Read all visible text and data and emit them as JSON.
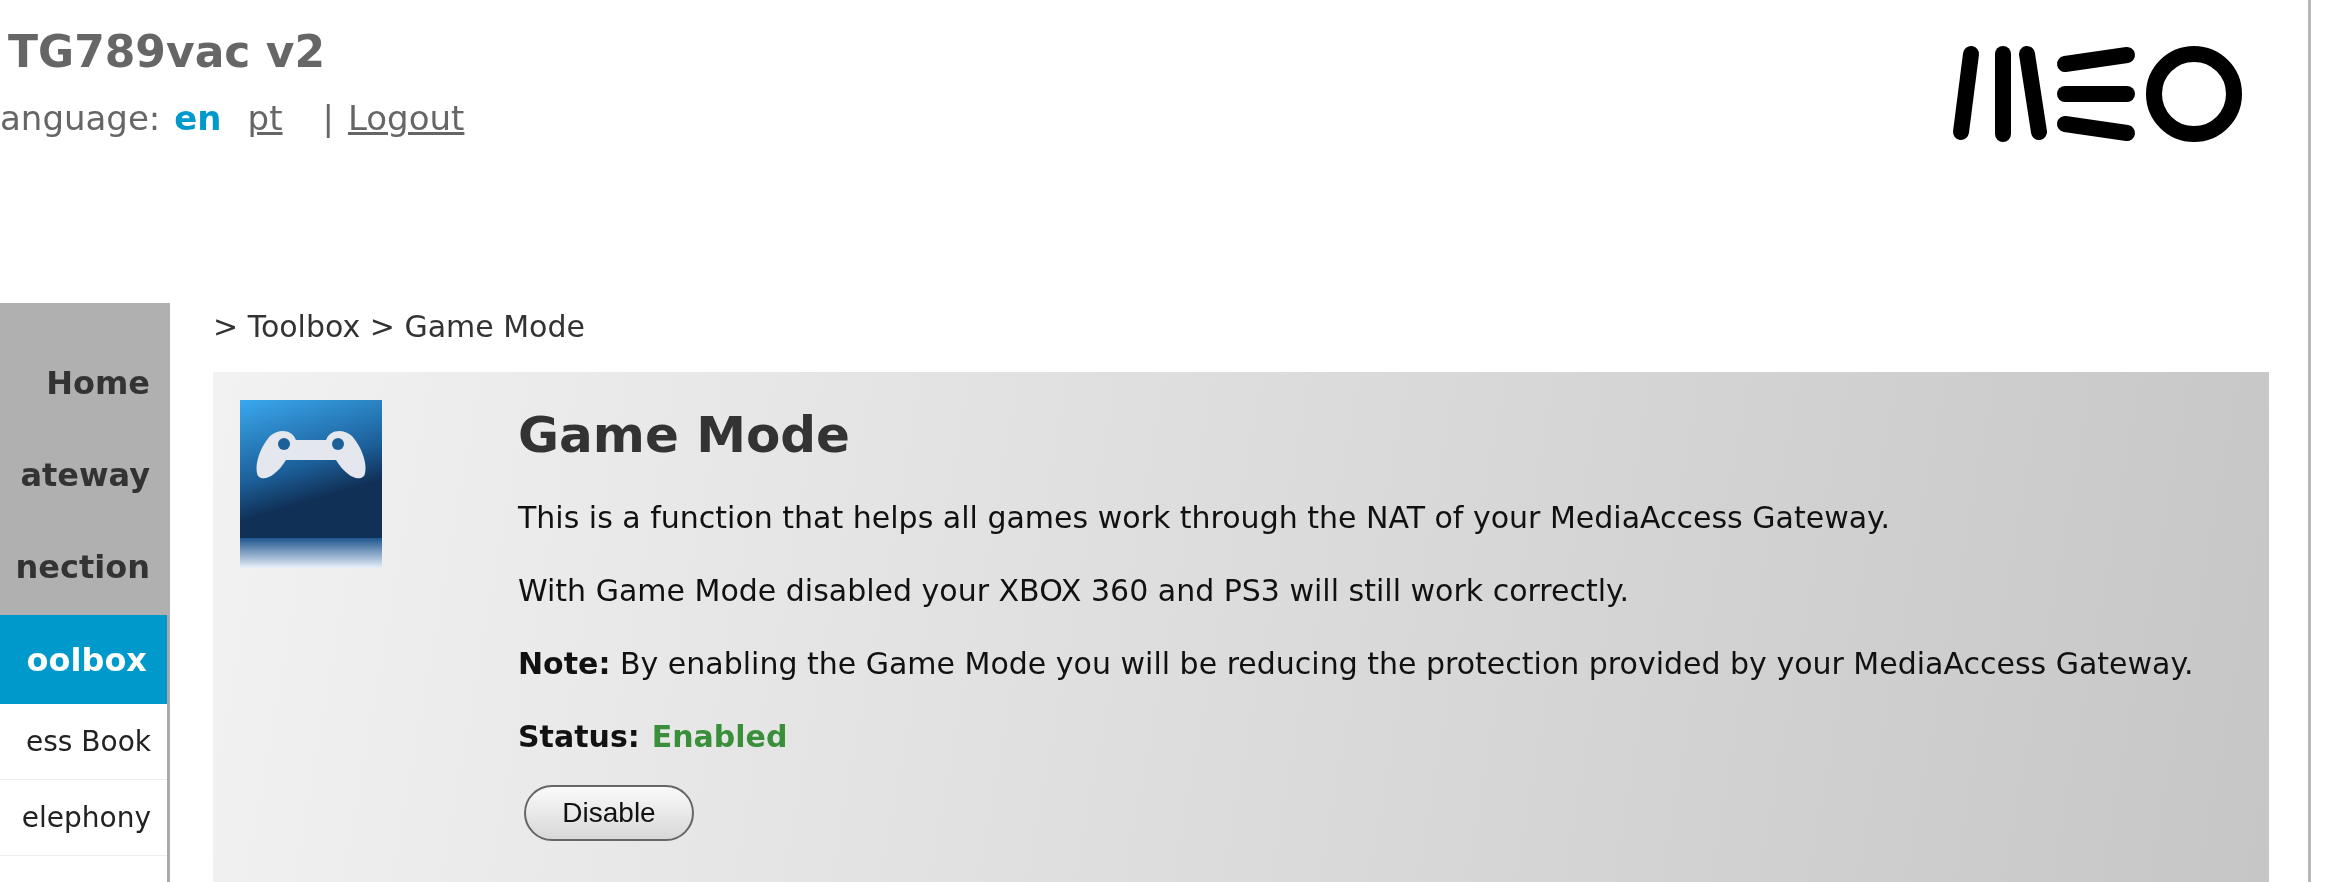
{
  "header": {
    "title": "TG789vac v2",
    "language_label": "anguage:",
    "languages": [
      {
        "label": "en",
        "selected": true
      },
      {
        "label": "pt",
        "selected": false
      }
    ],
    "separator": "|",
    "logout": "Logout"
  },
  "sidebar": {
    "items": [
      {
        "label": "Home",
        "kind": "main",
        "selected": false
      },
      {
        "label": "ateway",
        "kind": "main",
        "selected": false
      },
      {
        "label": "nection",
        "kind": "main",
        "selected": false
      },
      {
        "label": "oolbox",
        "kind": "main",
        "selected": true
      },
      {
        "label": "ess Book",
        "kind": "sub",
        "selected": false
      },
      {
        "label": "elephony",
        "kind": "sub",
        "selected": false
      }
    ]
  },
  "breadcrumb": "> Toolbox > Game Mode",
  "panel": {
    "title": "Game Mode",
    "paragraphs": [
      "This is a function that helps all games work through the NAT of your MediaAccess Gateway.",
      "With Game Mode disabled your XBOX 360 and PS3 will still work correctly.",
      "**Note:** By enabling the Game Mode you will be reducing the protection provided by your MediaAccess Gateway."
    ],
    "status": {
      "label": "Status:",
      "value": "Enabled",
      "enabled": true
    },
    "button": "Disable"
  }
}
